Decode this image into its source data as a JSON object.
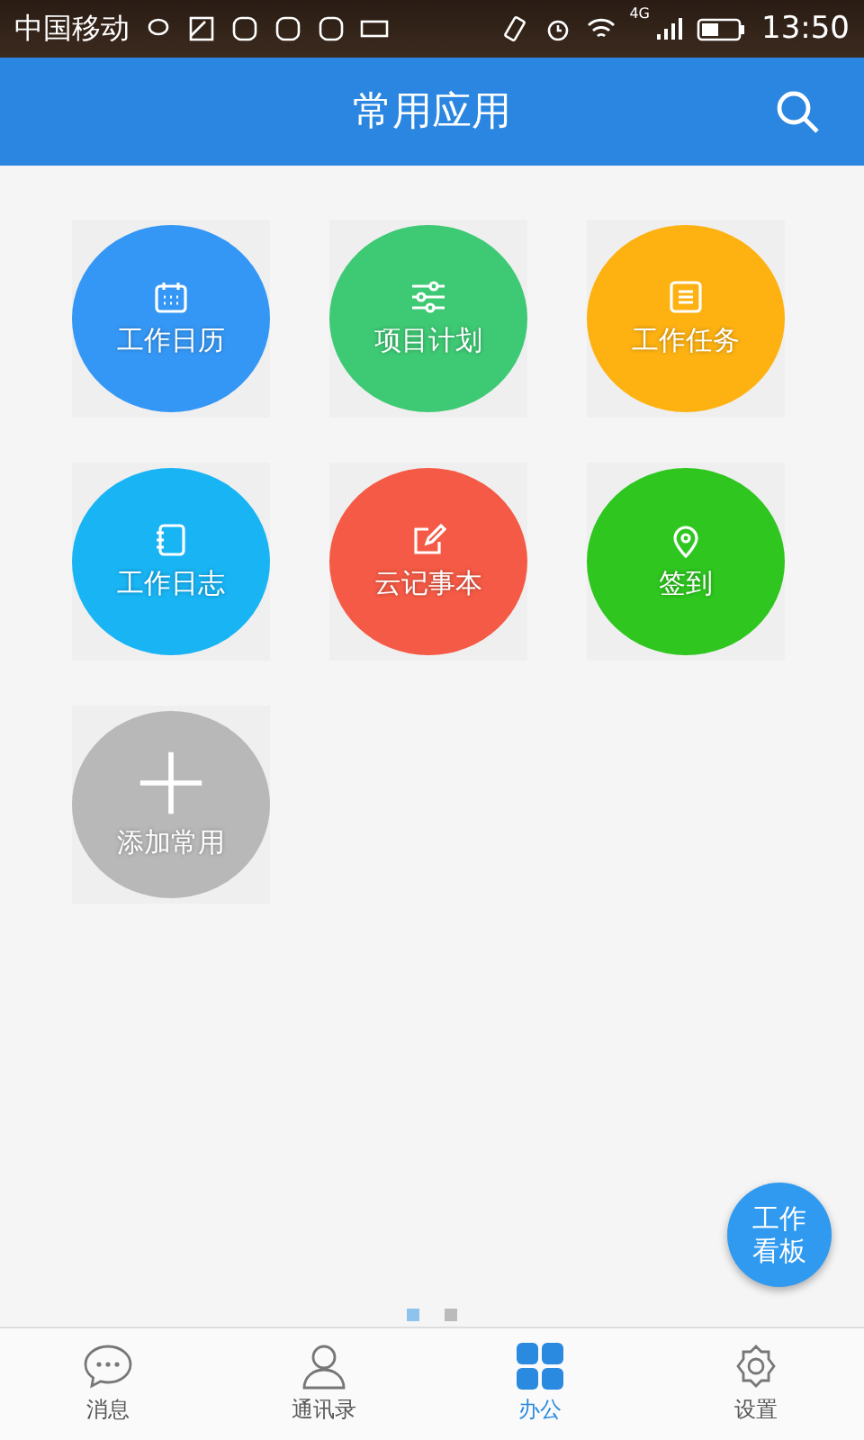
{
  "status_bar": {
    "carrier": "中国移动",
    "network": "4G",
    "time": "13:50"
  },
  "header": {
    "title": "常用应用"
  },
  "apps": [
    {
      "label": "工作日历",
      "kind": "calendar",
      "color": "#3597f5"
    },
    {
      "label": "项目计划",
      "kind": "sliders",
      "color": "#3ec974"
    },
    {
      "label": "工作任务",
      "kind": "list",
      "color": "#fdb212"
    },
    {
      "label": "工作日志",
      "kind": "notebook",
      "color": "#18b4f4"
    },
    {
      "label": "云记事本",
      "kind": "edit",
      "color": "#f45a45"
    },
    {
      "label": "签到",
      "kind": "location",
      "color": "#2ec61f"
    },
    {
      "label": "添加常用",
      "kind": "add",
      "color": "#b8b8b8"
    }
  ],
  "fab": {
    "label": "工作看板"
  },
  "pager": [
    {
      "selected": true
    },
    {
      "selected": false
    }
  ],
  "tabs": [
    {
      "label": "消息",
      "kind": "chat",
      "selected": false
    },
    {
      "label": "通讯录",
      "kind": "person",
      "selected": false
    },
    {
      "label": "办公",
      "kind": "grid",
      "selected": true
    },
    {
      "label": "设置",
      "kind": "gear",
      "selected": false
    }
  ]
}
